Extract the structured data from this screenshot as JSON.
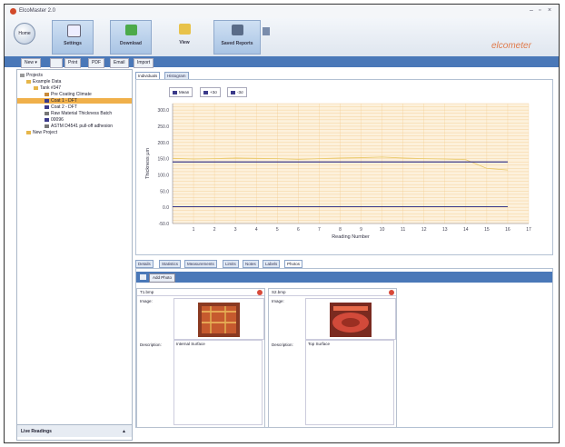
{
  "app": {
    "title": "ElcoMaster 2.0",
    "brand": "elcometer",
    "win_min": "–",
    "win_max": "▫",
    "win_close": "×"
  },
  "ribbon": {
    "home_label": "Home",
    "buttons": [
      {
        "label": "Settings",
        "icon": "settings-icon"
      },
      {
        "label": "Download",
        "icon": "download-icon"
      },
      {
        "label": "View",
        "icon": "view-icon"
      },
      {
        "label": "Saved Reports",
        "icon": "saved-reports-icon"
      },
      {
        "label": "",
        "icon": "extra-icon"
      }
    ]
  },
  "toolbar": {
    "new": "New",
    "print": "Print",
    "pdf": "PDF",
    "email": "Email",
    "import": "Import"
  },
  "tree": {
    "root": "Projects",
    "items": [
      {
        "label": "Example Data"
      },
      {
        "label": "Tank #347"
      },
      {
        "label": "Pre Coating Climate"
      },
      {
        "label": "Coat 1 - DFT"
      },
      {
        "label": "Coat 2 - DFT"
      },
      {
        "label": "Raw Material Thickness Batch"
      },
      {
        "label": "00096"
      },
      {
        "label": "ASTM D4541 pull-off adhesion"
      },
      {
        "label": "New Project"
      }
    ],
    "bottom": "Live Readings"
  },
  "top_tabs": [
    "Individuals",
    "Histogram"
  ],
  "chart_data": {
    "type": "line",
    "legend": [
      "Mean",
      "+3σ",
      "-3σ"
    ],
    "x_ticks": [
      1,
      2,
      3,
      4,
      5,
      6,
      7,
      8,
      9,
      10,
      11,
      12,
      13,
      14,
      15,
      16,
      17
    ],
    "y_ticks": [
      "300.0",
      "250.0",
      "200.0",
      "150.0",
      "100.0",
      "50.0",
      "0.0",
      "-50.0"
    ],
    "xlabel": "Reading Number",
    "ylabel": "Thickness µm",
    "xlim": [
      0,
      17
    ],
    "ylim": [
      -50,
      320
    ],
    "series": [
      {
        "name": "Readings",
        "values": [
          151,
          149,
          150,
          152,
          151,
          150,
          148,
          150,
          152,
          153,
          155,
          152,
          150,
          149,
          147,
          120,
          115
        ]
      },
      {
        "name": "Mean",
        "values": [
          140,
          140,
          140,
          140,
          140,
          140,
          140,
          140,
          140,
          140,
          140,
          140,
          140,
          140,
          140,
          140,
          140
        ]
      },
      {
        "name": "Lower",
        "values": [
          2,
          2,
          2,
          2,
          2,
          2,
          2,
          2,
          2,
          2,
          2,
          2,
          2,
          2,
          2,
          2,
          2
        ]
      }
    ],
    "colors": {
      "readings": "#e8c865",
      "mean": "#3b3a8a",
      "lower": "#3b3a8a",
      "band": "#fdf1dc",
      "grid": "#f2c98a"
    }
  },
  "lower_tabs": [
    "Details",
    "Statistics",
    "Measurements",
    "Limits",
    "Notes",
    "Labels",
    "Photos"
  ],
  "add_photo": "Add Photo",
  "photos": [
    {
      "name": "T1.bmp",
      "image_label": "Image:",
      "desc_label": "Description:",
      "description": "Internal Surface"
    },
    {
      "name": "S2.bmp",
      "image_label": "Image:",
      "desc_label": "Description:",
      "description": "Top Surface"
    }
  ]
}
